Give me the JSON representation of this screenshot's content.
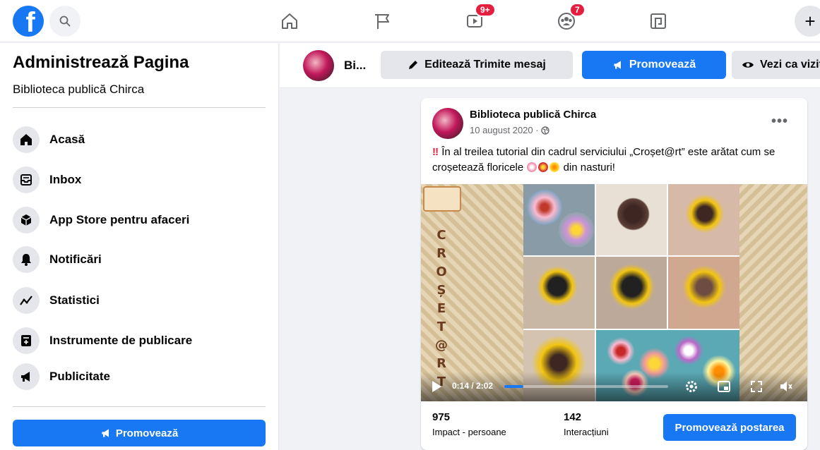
{
  "topbar": {
    "logo_letter": "f",
    "nav": [
      {
        "name": "home-icon",
        "badge": ""
      },
      {
        "name": "flag-icon",
        "badge": ""
      },
      {
        "name": "video-icon",
        "badge": "9+"
      },
      {
        "name": "groups-icon",
        "badge": "7"
      },
      {
        "name": "gaming-icon",
        "badge": ""
      }
    ],
    "plus_label": "+"
  },
  "sidebar": {
    "title": "Administrează Pagina",
    "subtitle": "Biblioteca publică Chirca",
    "items": [
      {
        "label": "Acasă",
        "icon": "home-icon"
      },
      {
        "label": "Inbox",
        "icon": "inbox-icon"
      },
      {
        "label": "App Store pentru afaceri",
        "icon": "box-icon"
      },
      {
        "label": "Notificări",
        "icon": "bell-icon"
      },
      {
        "label": "Statistici",
        "icon": "chart-icon"
      },
      {
        "label": "Instrumente de publicare",
        "icon": "publishing-tools-icon"
      },
      {
        "label": "Publicitate",
        "icon": "megaphone-icon"
      }
    ],
    "promote_label": "Promovează"
  },
  "page_bar": {
    "name_short": "Bi...",
    "edit_label": "Editează Trimite mesaj",
    "promote_label": "Promovează",
    "view_label": "Vezi ca vizitator"
  },
  "post": {
    "author": "Biblioteca publică Chirca",
    "date": "10 august 2020 ·",
    "text_before": "În al treilea tutorial din cadrul serviciului „Croșet@rt” este arătat cum se croșetează floricele",
    "text_after": "din nasturi!",
    "bang": "‼",
    "video": {
      "vertical_text": "CROȘET@RT",
      "current_time": "0:14",
      "duration": "2:02",
      "time_label": "0:14 / 2:02",
      "progress": 0.115
    },
    "stats": {
      "reach_value": "975",
      "reach_label": "Impact - persoane",
      "engagement_value": "142",
      "engagement_label": "Interacțiuni"
    },
    "promote_post_label": "Promovează postarea"
  },
  "colors": {
    "brand": "#1877f2",
    "badge": "#e41e3f",
    "bg": "#f0f2f5"
  }
}
